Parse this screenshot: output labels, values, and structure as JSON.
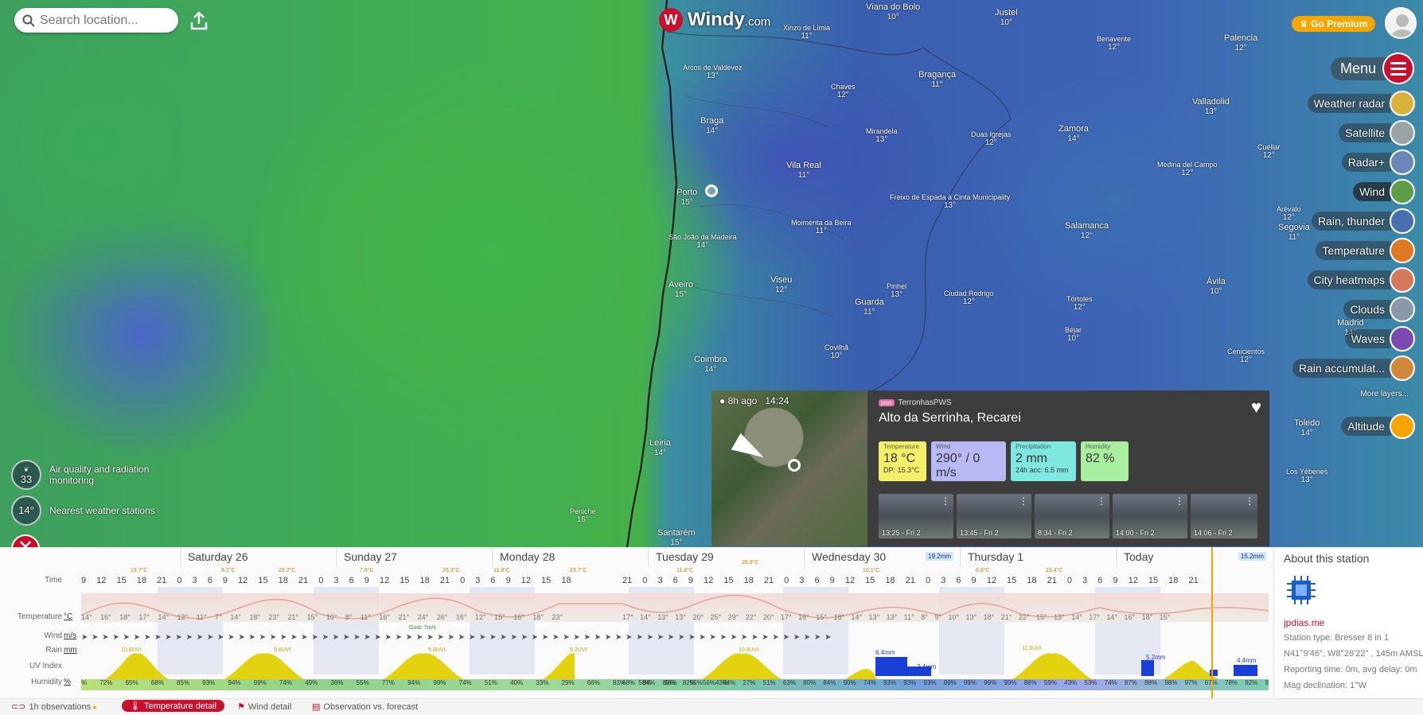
{
  "header": {
    "search_placeholder": "Search location...",
    "logo_text": "Windy",
    "logo_domain": ".com",
    "premium_label": "Go Premium",
    "menu_label": "Menu"
  },
  "cities": [
    {
      "name": "Viana do Bolo",
      "t": "10°"
    },
    {
      "name": "Justel",
      "t": "10°"
    },
    {
      "name": "Xinzo de Limia",
      "t": "11°"
    },
    {
      "name": "Benavente",
      "t": "12°"
    },
    {
      "name": "Palencia",
      "t": "12°"
    },
    {
      "name": "Arcos de Valdevez",
      "t": "13°"
    },
    {
      "name": "Bragança",
      "t": "11°"
    },
    {
      "name": "Chaves",
      "t": "12°"
    },
    {
      "name": "Braga",
      "t": "14°"
    },
    {
      "name": "Valladolid",
      "t": "13°"
    },
    {
      "name": "Mirandela",
      "t": "13°"
    },
    {
      "name": "Duas Igrejas",
      "t": "12°"
    },
    {
      "name": "Zamora",
      "t": "14°"
    },
    {
      "name": "Cuéllar",
      "t": "12°"
    },
    {
      "name": "Medina del Campo",
      "t": "12°"
    },
    {
      "name": "Porto",
      "t": "15°"
    },
    {
      "name": "Vila Real",
      "t": "11°"
    },
    {
      "name": "Freixo de Espada à Cinta Municipality",
      "t": "13°"
    },
    {
      "name": "Arévalo",
      "t": "12°"
    },
    {
      "name": "São João da Madeira",
      "t": "14°"
    },
    {
      "name": "Moimenta da Beira",
      "t": "11°"
    },
    {
      "name": "Salamanca",
      "t": "12°"
    },
    {
      "name": "Segovia",
      "t": "11°"
    },
    {
      "name": "Aveiro",
      "t": "15°"
    },
    {
      "name": "Viseu",
      "t": "12°"
    },
    {
      "name": "Pinhel",
      "t": "13°"
    },
    {
      "name": "Ciudad Rodrigo",
      "t": "12°"
    },
    {
      "name": "Ávila",
      "t": "10°"
    },
    {
      "name": "Guarda",
      "t": "11°"
    },
    {
      "name": "Tórtoles",
      "t": "12°"
    },
    {
      "name": "Madrid",
      "t": "14°"
    },
    {
      "name": "Béjar",
      "t": "10°"
    },
    {
      "name": "Covilhã",
      "t": "10°"
    },
    {
      "name": "Cenicientos",
      "t": "12°"
    },
    {
      "name": "Coimbra",
      "t": "14°"
    },
    {
      "name": "Leiria",
      "t": "14°"
    },
    {
      "name": "Toledo",
      "t": "14°"
    },
    {
      "name": "Los Yébenes",
      "t": "13°"
    },
    {
      "name": "Peniche",
      "t": "16°"
    },
    {
      "name": "Santarém",
      "t": "15°"
    }
  ],
  "layers": [
    {
      "label": "Weather radar",
      "color": "#d9b23a"
    },
    {
      "label": "Satellite",
      "color": "#9aa3a5"
    },
    {
      "label": "Radar+",
      "color": "#6b86b8"
    },
    {
      "label": "Wind",
      "color": "#5e9e48"
    },
    {
      "label": "Rain, thunder",
      "color": "#4a6fb0"
    },
    {
      "label": "Temperature",
      "color": "#e07a22"
    },
    {
      "label": "City heatmaps",
      "color": "#d47a5a"
    },
    {
      "label": "Clouds",
      "color": "#8a97a8"
    },
    {
      "label": "Waves",
      "color": "#7a4ab0"
    },
    {
      "label": "Rain accumulat...",
      "color": "#d08a3a"
    },
    {
      "label": "Altitude",
      "color": "#f7a600"
    }
  ],
  "more_layers": "More layers...",
  "left_widgets": {
    "aq_value": "33",
    "aq_label": "Air quality and radiation monitoring",
    "ws_value": "14°",
    "ws_label": "Nearest weather stations"
  },
  "popup": {
    "date": "8h ago",
    "time": "14:24",
    "station_tag": "pws",
    "station_name": "TerronhasPWS",
    "title": "Alto da Serrinha, Recarei",
    "chips": [
      {
        "key": "Temperature",
        "value": "18 °C",
        "sub": "DP: 15.3°C",
        "color": "#f5f06a"
      },
      {
        "key": "Wind",
        "value": "290° / 0 m/s",
        "sub": "",
        "color": "#b8b8f5"
      },
      {
        "key": "Precipitation",
        "value": "2 mm",
        "sub": "24h acc: 6.5 mm",
        "color": "#7ee8e0"
      },
      {
        "key": "Humidity",
        "value": "82 %",
        "sub": "",
        "color": "#a8f0a0"
      }
    ],
    "thumbs": [
      "13:25 - Fri 2",
      "13:45 - Fri 2",
      "8:34 - Fri 2",
      "14:00 - Fri 2",
      "14:06 - Fri 2"
    ]
  },
  "timeline": {
    "days": [
      "Saturday 26",
      "Sunday 27",
      "Monday 28",
      "Tuesday 29",
      "Wednesday 30",
      "Thursday 1",
      "Today"
    ],
    "day_badges": [
      "19.2mm",
      "15.2mm"
    ],
    "row_labels": {
      "time": "Time",
      "temperature": "Temperature",
      "wind": "Wind",
      "rain": "Rain",
      "uv": "UV Index",
      "humidity": "Humidity"
    },
    "units": {
      "temperature": "°C",
      "wind": "m/s",
      "rain": "mm",
      "humidity": "%"
    },
    "hours_a": "9 12 15 18 21 0 3 6 9 12 15 18 21 0 3 6 9 12 15 18 21 0 3 6 9 12 15 18",
    "hours_b": "21 0 3 6 9 12 15 18 21 0 3 6 9 12 15 18 21 0 3 6 9 12 15 18 21 0 3 6 9 12 15 18 21",
    "temps_a": "14° 16° 18° 17° 14° 12° 11° 7° 14° 18° 23° 21° 15° 10° 8° 11° 16° 21° 24° 26° 16° 12° 15° 16° 18° 23°",
    "temps_b": "17° 14° 13° 13° 20° 25° 29° 22° 20° 17° 16° 15° 18° 14° 13° 13° 11° 8° 9° 10° 13° 18° 21° 22° 15° 13° 14° 17° 14° 16° 18° 15°",
    "wind_arrows": "➤ ➤ ➤ ➤ ➤ ➤ ➤ ➤ ➤ ➤ ➤ ➤ ➤ ➤ ➤ ➤ ➤ ➤ ➤ ➤ ➤ ➤ ➤ ➤ ➤ ➤ ➤ ➤ ➤ ➤ ➤ ➤ ➤ ➤ ➤ ➤ ➤ ➤ ➤ ➤ ➤ ➤ ➤ ➤ ➤ ➤ ➤ ➤ ➤ ➤ ➤ ➤ ➤ ➤ ➤ ➤ ➤ ➤ ➤ ➤ ➤ ➤ ➤ ➤ ➤ ➤ ➤ ➤ ➤ ➤ ➤ ➤",
    "gust_label": "Gust: 7m/s",
    "humidity_a": "% 72% 65% 68% 85% 93% 94% 99% 74% 49% 36% 55% 77% 94% 99% 74% 51% 40% 33% 29% 66% 83% 58% 56% 55% 43%",
    "humidity_b": "68% 84% 89% 82% 56% 44% 27% 51% 63% 80% 84% 90% 74% 93% 93% 93% 99% 99% 99% 99% 88% 59% 43% 53% 74% 87% 88% 98% 97% 67% 78% 92% 93%",
    "tmax_marks": [
      "19.7°C",
      "8.2°C",
      "23.2°C",
      "7.6°C",
      "26.3°C",
      "11.8°C",
      "23.7°C",
      "11.8°C",
      "28.9°C",
      "10.1°C",
      "6.8°C",
      "23.4°C"
    ],
    "uv_marks": [
      "10.8UVI",
      "9.8UVI",
      "9.8UVI",
      "9.2UVI",
      "10.8UVI",
      "11.6UVI"
    ],
    "rain_marks": [
      "6.4mm",
      "2.4mm",
      "5.2mm",
      "4.4mm"
    ]
  },
  "about": {
    "title": "About this station",
    "link": "jpdias.me",
    "lines": [
      "Station type: Bresser 8 in 1",
      "N41°9'46\", W8°26'22\" , 145m AMSL",
      "Reporting time: 0m, avg delay: 0m",
      "Mag declination: 1°W"
    ]
  },
  "bottom_tabs": {
    "obs": "1h observations",
    "temp": "Temperature detail",
    "wind": "Wind detail",
    "vs": "Observation vs. forecast"
  }
}
